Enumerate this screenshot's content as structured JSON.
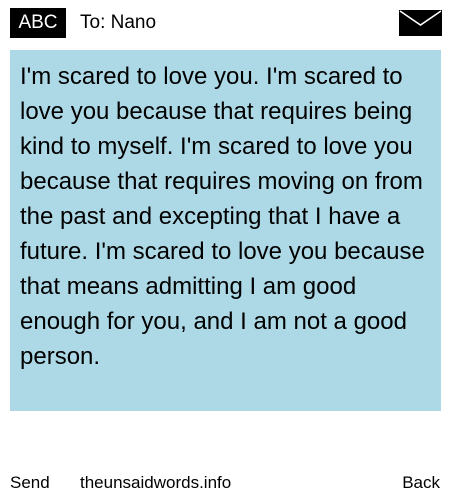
{
  "header": {
    "input_mode": "ABC",
    "recipient": "To: Nano",
    "icon": "envelope-icon"
  },
  "message": {
    "text": "I'm scared to love you. I'm scared to love you because that requires being kind to myself. I'm scared to love you because that requires moving on from the past and excepting that I have a future. I'm scared to love you because that means admitting I am good enough for you, and I am not a good person."
  },
  "footer": {
    "left_softkey": "Send",
    "site": "theunsaidwords.info",
    "right_softkey": "Back"
  },
  "colors": {
    "message_background": "#add8e6",
    "badge_background": "#000000",
    "badge_text": "#ffffff"
  }
}
